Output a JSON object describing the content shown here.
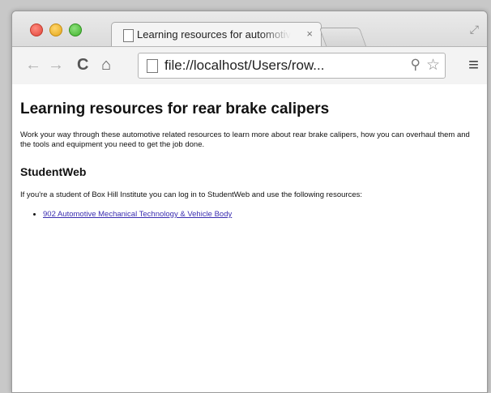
{
  "browser": {
    "tab_title": "Learning resources for automotive",
    "tab_close_glyph": "×",
    "url": "file://localhost/Users/row..."
  },
  "icons": {
    "back": "back-arrow-icon",
    "forward": "forward-arrow-icon",
    "reload": "reload-icon",
    "home": "home-icon",
    "zoom": "magnifier-icon",
    "bookmark": "star-icon",
    "menu": "hamburger-menu-icon",
    "fullscreen": "fullscreen-arrows-icon"
  },
  "page": {
    "title": "Learning resources for rear brake calipers",
    "intro": "Work your way through these automotive related resources to learn more about rear brake calipers, how you can overhaul them and the tools and equipment you need to get the job done.",
    "section_heading": "StudentWeb",
    "section_text": "If you're a student of Box Hill Institute you can log in to StudentWeb and use the following resources:",
    "links": [
      "902 Automotive Mechanical Technology & Vehicle Body"
    ]
  },
  "colors": {
    "link": "#3a2db0"
  }
}
